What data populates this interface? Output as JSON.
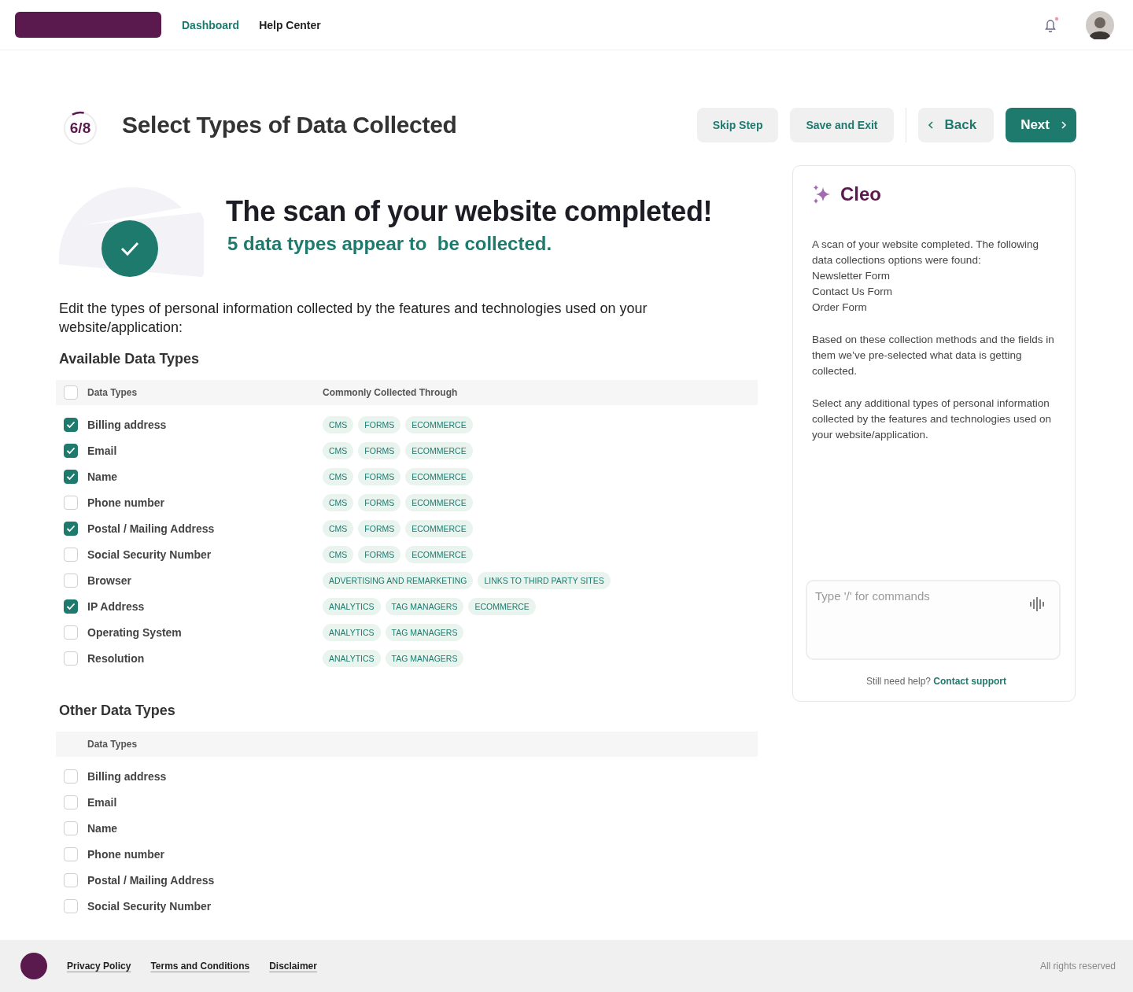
{
  "header": {
    "nav": [
      {
        "label": "Dashboard",
        "selected": true
      },
      {
        "label": "Help Center",
        "selected": false
      }
    ]
  },
  "step": {
    "label": "6/8",
    "level": 0.12
  },
  "title": "Select Types of Data Collected",
  "actions": [
    {
      "label": "Skip Step",
      "kind": "secondary"
    },
    {
      "label": "Save and Exit",
      "kind": "secondary"
    },
    {
      "label": "Back",
      "kind": "back"
    },
    {
      "label": "Next",
      "kind": "next"
    }
  ],
  "scan": {
    "heading": "The scan of your website completed!",
    "subheading": "5 data types appear to  be collected."
  },
  "intro": "Edit the types of personal information collected by the features and technologies used on your website/application:",
  "available": {
    "title": "Available Data Types",
    "all_checked": false,
    "columns": [
      "Data Types",
      "Commonly Collected Through"
    ],
    "rows": [
      {
        "name": "Billing address",
        "checked": true,
        "tags": [
          "CMS",
          "FORMS",
          "ECOMMERCE"
        ]
      },
      {
        "name": "Email",
        "checked": true,
        "tags": [
          "CMS",
          "FORMS",
          "ECOMMERCE"
        ]
      },
      {
        "name": "Name",
        "checked": true,
        "tags": [
          "CMS",
          "FORMS",
          "ECOMMERCE"
        ]
      },
      {
        "name": "Phone number",
        "checked": false,
        "tags": [
          "CMS",
          "FORMS",
          "ECOMMERCE"
        ]
      },
      {
        "name": "Postal / Mailing Address",
        "checked": true,
        "tags": [
          "CMS",
          "FORMS",
          "ECOMMERCE"
        ]
      },
      {
        "name": "Social Security Number",
        "checked": false,
        "tags": [
          "CMS",
          "FORMS",
          "ECOMMERCE"
        ]
      },
      {
        "name": "Browser",
        "checked": false,
        "tags": [
          "ADVERTISING AND REMARKETING",
          "LINKS TO THIRD PARTY SITES"
        ]
      },
      {
        "name": "IP Address",
        "checked": true,
        "tags": [
          "ANALYTICS",
          "TAG MANAGERS",
          "ECOMMERCE"
        ]
      },
      {
        "name": "Operating System",
        "checked": false,
        "tags": [
          "ANALYTICS",
          "TAG MANAGERS"
        ]
      },
      {
        "name": "Resolution",
        "checked": false,
        "tags": [
          "ANALYTICS",
          "TAG MANAGERS"
        ]
      }
    ]
  },
  "other": {
    "title": "Other Data Types",
    "columns": [
      "Data Types"
    ],
    "rows": [
      {
        "name": "Billing address",
        "checked": false
      },
      {
        "name": "Email",
        "checked": false
      },
      {
        "name": "Name",
        "checked": false
      },
      {
        "name": "Phone number",
        "checked": false
      },
      {
        "name": "Postal / Mailing Address",
        "checked": false
      },
      {
        "name": "Social Security Number",
        "checked": false
      }
    ]
  },
  "assistant": {
    "name": "Cleo",
    "paragraphs": [
      [
        "A scan of your website completed. The following data collections options were found:",
        "Newsletter Form",
        "Contact Us Form",
        "Order Form"
      ],
      [
        "Based on these collection methods and the fields in them we’ve pre-selected what data is getting collected."
      ],
      [
        "Select any additional types of personal information collected by the features and technologies used on your website/application."
      ]
    ],
    "placeholder": "Type '/' for commands",
    "help_text": "Still need help?",
    "help_link": "Contact support"
  },
  "footer": {
    "links": [
      "Privacy Policy",
      "Terms and Conditions",
      "Disclaimer"
    ],
    "copyright": "All rights reserved"
  }
}
